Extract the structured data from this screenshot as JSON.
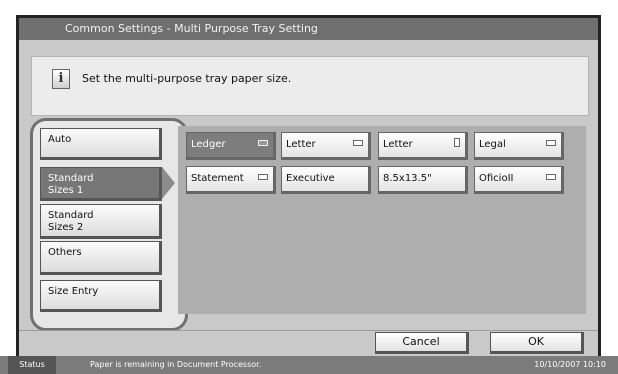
{
  "window": {
    "title": "Common Settings - Multi Purpose Tray Setting"
  },
  "message": {
    "icon": "info-icon",
    "text": "Set the multi-purpose tray paper size."
  },
  "categories": [
    {
      "label": "Auto",
      "selected": false
    },
    {
      "label": "Standard\nSizes 1",
      "selected": true
    },
    {
      "label": "Standard\nSizes 2",
      "selected": false
    },
    {
      "label": "Others",
      "selected": false
    },
    {
      "label": "Size Entry",
      "selected": false
    }
  ],
  "sizes": [
    {
      "label": "Ledger",
      "icon": "paper-landscape-icon",
      "selected": true
    },
    {
      "label": "Letter",
      "icon": "paper-landscape-icon",
      "selected": false
    },
    {
      "label": "Letter",
      "icon": "paper-portrait-icon",
      "selected": false
    },
    {
      "label": "Legal",
      "icon": "paper-landscape-icon",
      "selected": false
    },
    {
      "label": "Statement",
      "icon": "paper-landscape-icon",
      "selected": false
    },
    {
      "label": "Executive",
      "icon": "",
      "selected": false
    },
    {
      "label": "8.5x13.5\"",
      "icon": "",
      "selected": false
    },
    {
      "label": "OficioII",
      "icon": "paper-landscape-icon",
      "selected": false
    }
  ],
  "actions": {
    "cancel": "Cancel",
    "ok": "OK"
  },
  "status": {
    "label": "Status",
    "text": "Paper is remaining in Document Processor.",
    "datetime": "10/10/2007   10:10"
  }
}
